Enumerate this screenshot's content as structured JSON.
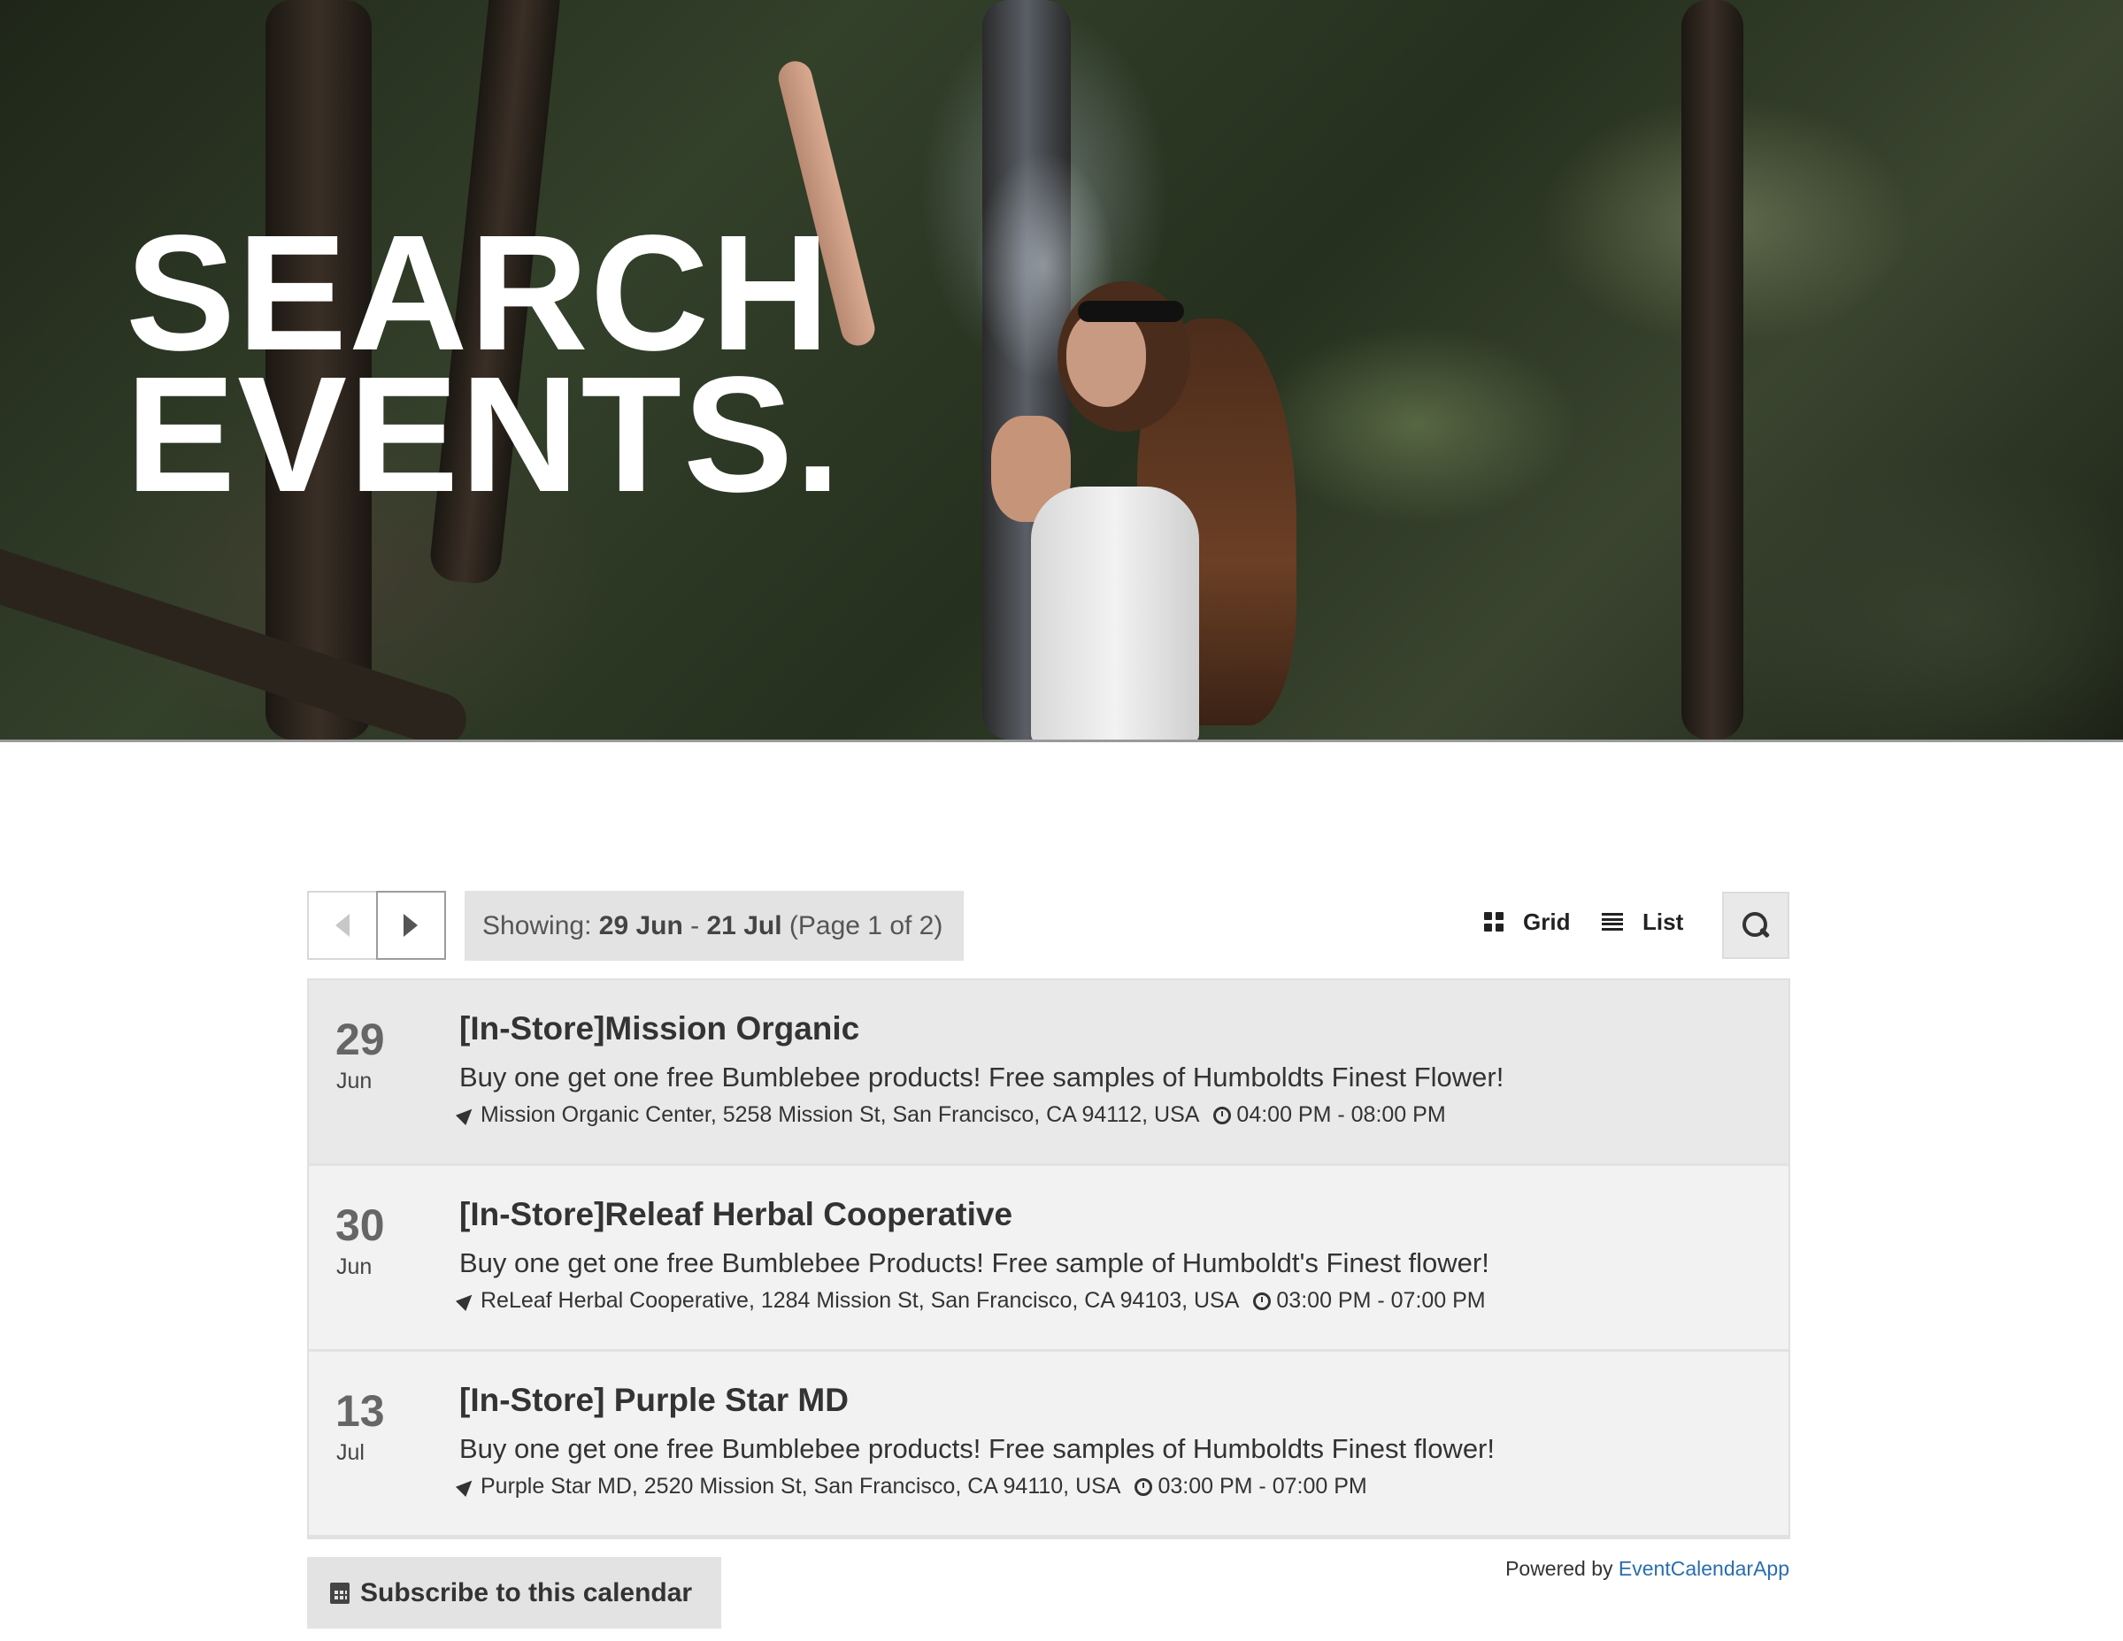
{
  "hero": {
    "title_line1": "SEARCH",
    "title_line2": "EVENTS."
  },
  "toolbar": {
    "prev_icon": "chevron-left-icon",
    "next_icon": "chevron-right-icon",
    "showing_label": "Showing:",
    "range_start": "29 Jun",
    "range_sep": "-",
    "range_end": "21 Jul",
    "page_info": "(Page 1 of 2)",
    "grid_label": "Grid",
    "list_label": "List",
    "search_icon": "search-icon"
  },
  "events": [
    {
      "day": "29",
      "month": "Jun",
      "title": "[In-Store]Mission Organic",
      "description": "Buy one get one free Bumblebee products! Free samples of Humboldts Finest Flower!",
      "location": "Mission Organic Center, 5258 Mission St, San Francisco, CA 94112, USA",
      "time": "04:00 PM - 08:00 PM"
    },
    {
      "day": "30",
      "month": "Jun",
      "title": "[In-Store]Releaf Herbal Cooperative",
      "description": "Buy one get one free Bumblebee Products! Free sample of Humboldt's Finest flower!",
      "location": "ReLeaf Herbal Cooperative, 1284 Mission St, San Francisco, CA 94103, USA",
      "time": "03:00 PM - 07:00 PM"
    },
    {
      "day": "13",
      "month": "Jul",
      "title": "[In-Store] Purple Star MD",
      "description": "Buy one get one free Bumblebee products! Free samples of Humboldts Finest flower!",
      "location": "Purple Star MD, 2520 Mission St, San Francisco, CA 94110, USA",
      "time": "03:00 PM - 07:00 PM"
    }
  ],
  "footer": {
    "subscribe_label": "Subscribe to this calendar",
    "powered_by": "Powered by",
    "powered_link": "EventCalendarApp"
  },
  "colors": {
    "link": "#2a6db0",
    "button_bg": "#e3e3e3",
    "row_bg": "#f2f2f2"
  }
}
